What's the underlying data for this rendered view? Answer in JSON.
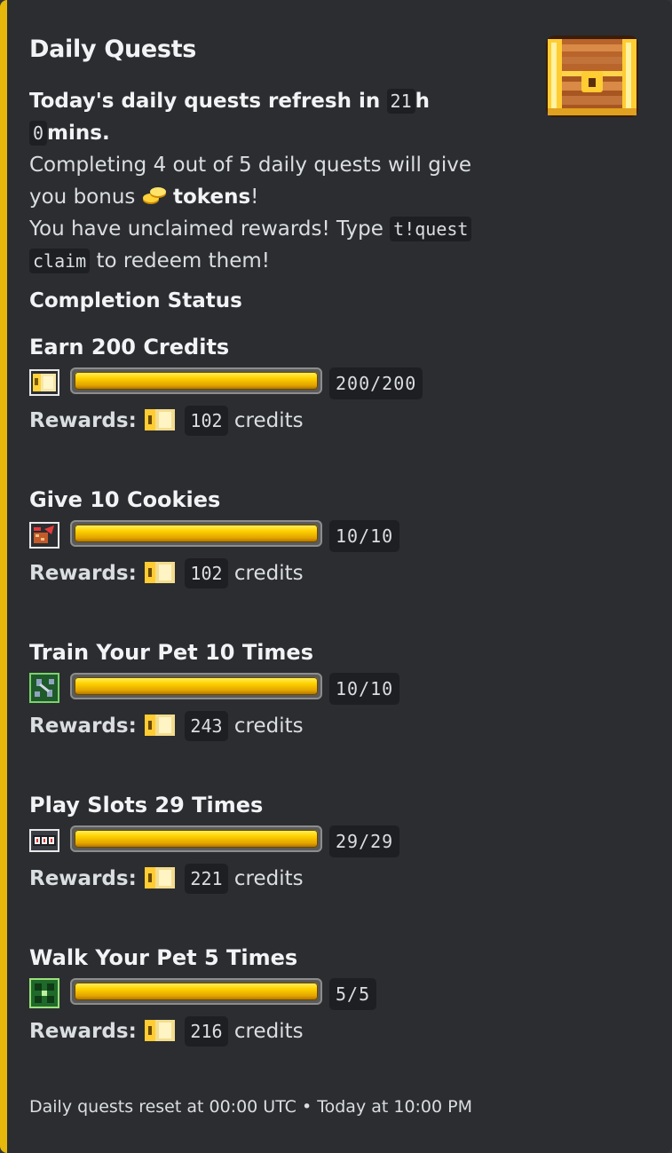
{
  "embed": {
    "accent_color": "#e5b80b",
    "title": "Daily Quests",
    "thumbnail_icon": "treasure-chest-icon",
    "refresh": {
      "prefix": "Today's daily quests refresh in",
      "hours": "21",
      "hours_unit": "h",
      "minutes": "0",
      "minutes_unit": "mins."
    },
    "bonus_text": "Completing 4 out of 5 daily quests will give",
    "bonus_text2": "you bonus",
    "bonus_icon": "coins-icon",
    "bonus_tokens": "tokens",
    "bonus_end": "!",
    "unclaimed_text": "You have unclaimed rewards! Type",
    "claim_code_1": "t!quest",
    "claim_code_2": "claim",
    "unclaimed_end": "to redeem them!",
    "section_title": "Completion Status",
    "reward_label": "Rewards:",
    "reward_unit": "credits",
    "reward_icon": "credit-ticket-icon",
    "footer": "Daily quests reset at 00:00 UTC • Today at 10:00 PM"
  },
  "quests": [
    {
      "name": "Earn 200 Credits",
      "icon": "credit-card-icon",
      "progress": "200/200",
      "fraction": 1.0,
      "reward": "102"
    },
    {
      "name": "Give 10 Cookies",
      "icon": "cookie-gift-icon",
      "progress": "10/10",
      "fraction": 1.0,
      "reward": "102"
    },
    {
      "name": "Train Your Pet 10 Times",
      "icon": "dumbbell-icon",
      "progress": "10/10",
      "fraction": 1.0,
      "reward": "243"
    },
    {
      "name": "Play Slots 29 Times",
      "icon": "slot-machine-icon",
      "progress": "29/29",
      "fraction": 1.0,
      "reward": "221"
    },
    {
      "name": "Walk Your Pet 5 Times",
      "icon": "paw-walk-icon",
      "progress": "5/5",
      "fraction": 1.0,
      "reward": "216"
    }
  ]
}
